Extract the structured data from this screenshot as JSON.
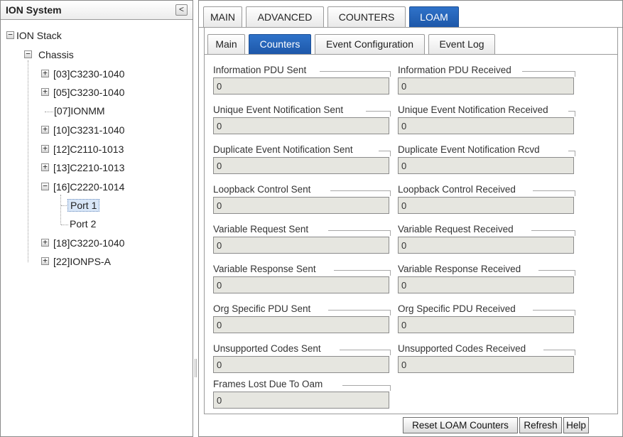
{
  "tree": {
    "title": "ION System",
    "collapse_glyph": "<",
    "nodes": [
      {
        "label": "ION Stack",
        "expander": "−"
      },
      {
        "label": "Chassis",
        "expander": "−"
      },
      {
        "label": "[03]C3230-1040",
        "expander": "+"
      },
      {
        "label": "[05]C3230-1040",
        "expander": "+"
      },
      {
        "label": "[07]IONMM",
        "expander": ""
      },
      {
        "label": "[10]C3231-1040",
        "expander": "+"
      },
      {
        "label": "[12]C2110-1013",
        "expander": "+"
      },
      {
        "label": "[13]C2210-1013",
        "expander": "+"
      },
      {
        "label": "[16]C2220-1014",
        "expander": "−"
      },
      {
        "label": "Port 1",
        "expander": ""
      },
      {
        "label": "Port 2",
        "expander": ""
      },
      {
        "label": "[18]C3220-1040",
        "expander": "+"
      },
      {
        "label": "[22]IONPS-A",
        "expander": "+"
      }
    ]
  },
  "top_tabs": [
    "MAIN",
    "ADVANCED",
    "COUNTERS",
    "LOAM"
  ],
  "active_top_tab": "LOAM",
  "sub_tabs": [
    "Main",
    "Counters",
    "Event Configuration",
    "Event Log"
  ],
  "active_sub_tab": "Counters",
  "counters": [
    {
      "label": "Information PDU Sent",
      "value": "0"
    },
    {
      "label": "Information PDU Received",
      "value": "0"
    },
    {
      "label": "Unique Event Notification Sent",
      "value": "0"
    },
    {
      "label": "Unique Event Notification Received",
      "value": "0"
    },
    {
      "label": "Duplicate Event Notification Sent",
      "value": "0"
    },
    {
      "label": "Duplicate Event Notification Rcvd",
      "value": "0"
    },
    {
      "label": "Loopback Control Sent",
      "value": "0"
    },
    {
      "label": "Loopback Control Received",
      "value": "0"
    },
    {
      "label": "Variable Request Sent",
      "value": "0"
    },
    {
      "label": "Variable Request Received",
      "value": "0"
    },
    {
      "label": "Variable Response Sent",
      "value": "0"
    },
    {
      "label": "Variable Response Received",
      "value": "0"
    },
    {
      "label": "Org Specific PDU Sent",
      "value": "0"
    },
    {
      "label": "Org Specific PDU Received",
      "value": "0"
    },
    {
      "label": "Unsupported Codes Sent",
      "value": "0"
    },
    {
      "label": "Unsupported Codes Received",
      "value": "0"
    },
    {
      "label": "Frames Lost Due To Oam",
      "value": "0"
    }
  ],
  "buttons": {
    "reset": "Reset LOAM Counters",
    "refresh": "Refresh",
    "help": "Help"
  }
}
